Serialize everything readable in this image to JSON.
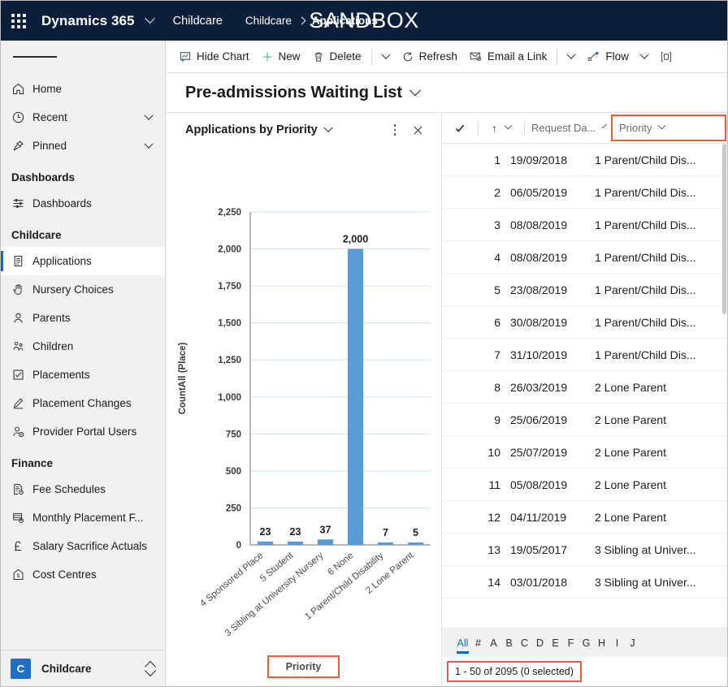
{
  "topbar": {
    "waffle_icon": "app-launcher-icon",
    "brand": "Dynamics 365",
    "brand_chevron_icon": "chevron-down-icon",
    "app_name": "Childcare",
    "breadcrumb_root": "Childcare",
    "breadcrumb_sep_icon": "chevron-right-icon",
    "breadcrumb_current": "Applications",
    "environment_banner": "SANDBOX"
  },
  "sidebar": {
    "hamburger_icon": "hamburger-menu-icon",
    "quick": [
      {
        "label": "Home",
        "icon": "home-icon",
        "chevron": false
      },
      {
        "label": "Recent",
        "icon": "clock-icon",
        "chevron": true
      },
      {
        "label": "Pinned",
        "icon": "pin-icon",
        "chevron": true
      }
    ],
    "groups": [
      {
        "title": "Dashboards",
        "items": [
          {
            "label": "Dashboards",
            "icon": "dashboard-icon",
            "active": false
          }
        ]
      },
      {
        "title": "Childcare",
        "items": [
          {
            "label": "Applications",
            "icon": "document-icon",
            "active": true
          },
          {
            "label": "Nursery Choices",
            "icon": "hand-icon",
            "active": false
          },
          {
            "label": "Parents",
            "icon": "person-icon",
            "active": false
          },
          {
            "label": "Children",
            "icon": "children-icon",
            "active": false
          },
          {
            "label": "Placements",
            "icon": "checkbox-icon",
            "active": false
          },
          {
            "label": "Placement Changes",
            "icon": "pencil-icon",
            "active": false
          },
          {
            "label": "Provider Portal Users",
            "icon": "person-settings-icon",
            "active": false
          }
        ]
      },
      {
        "title": "Finance",
        "items": [
          {
            "label": "Fee Schedules",
            "icon": "document-clock-icon",
            "active": false
          },
          {
            "label": "Monthly Placement F...",
            "icon": "list-clock-icon",
            "active": false
          },
          {
            "label": "Salary Sacrifice Actuals",
            "icon": "pound-icon",
            "active": false
          },
          {
            "label": "Cost Centres",
            "icon": "building-money-icon",
            "active": false
          }
        ]
      }
    ],
    "app_switcher": {
      "badge": "C",
      "label": "Childcare",
      "icon": "up-down-chevron-icon"
    }
  },
  "command_bar": {
    "items": [
      {
        "label": "Hide Chart",
        "icon": "chart-hide-icon"
      },
      {
        "label": "New",
        "icon": "plus-icon"
      },
      {
        "label": "Delete",
        "icon": "trash-icon"
      }
    ],
    "overflow_icon": "chevron-down-icon",
    "refresh": {
      "label": "Refresh",
      "icon": "refresh-icon"
    },
    "email_link": {
      "label": "Email a Link",
      "icon": "email-icon"
    },
    "email_chevron_icon": "chevron-down-icon",
    "flow": {
      "label": "Flow",
      "icon": "flow-icon"
    },
    "flow_chevron_icon": "chevron-down-icon",
    "run_report_icon": "run-report-icon"
  },
  "view": {
    "title": "Pre-admissions Waiting List",
    "chevron_icon": "chevron-down-icon"
  },
  "chart_panel": {
    "title": "Applications by Priority",
    "title_chevron_icon": "chevron-down-icon",
    "more_icon": "kebab-menu-icon",
    "close_icon": "close-icon",
    "legend_label": "Priority",
    "highlight_color": "#f05a3c"
  },
  "chart_data": {
    "type": "bar",
    "title": "Applications by Priority",
    "xlabel": "Priority",
    "ylabel": "CountAll (Place)",
    "categories": [
      "4 Sponsored Place",
      "5 Student",
      "3 Sibling at University Nursery",
      "6 None",
      "1 Parent/Child Disability",
      "2 Lone Parent"
    ],
    "values": [
      23,
      23,
      37,
      2000,
      7,
      5
    ],
    "data_labels": [
      "23",
      "23",
      "37",
      "2,000",
      "7",
      "5"
    ],
    "ylim": [
      0,
      2250
    ],
    "yticks": [
      0,
      250,
      500,
      750,
      1000,
      1250,
      1500,
      1750,
      2000,
      2250
    ],
    "ytick_labels": [
      "0",
      "250",
      "500",
      "750",
      "1,000",
      "1,250",
      "1,500",
      "1,750",
      "2,000",
      "2,250"
    ],
    "grid": true,
    "legend": "bottom",
    "bar_color": "#5b9bd5",
    "gridline_color": "#cfe2f3"
  },
  "grid": {
    "header": {
      "select_all_icon": "checkmark-icon",
      "sort_arrow_icon": "sort-ascending-icon",
      "sort_chevron_icon": "chevron-down-icon",
      "columns": [
        {
          "label": "Request Da...",
          "chevron_icon": "chevron-down-icon",
          "highlighted": false
        },
        {
          "label": "Priority",
          "chevron_icon": "chevron-down-icon",
          "highlighted": true
        }
      ]
    },
    "rows": [
      {
        "index": "1",
        "date": "19/09/2018",
        "priority": "1 Parent/Child Dis..."
      },
      {
        "index": "2",
        "date": "06/05/2019",
        "priority": "1 Parent/Child Dis..."
      },
      {
        "index": "3",
        "date": "08/08/2019",
        "priority": "1 Parent/Child Dis..."
      },
      {
        "index": "4",
        "date": "08/08/2019",
        "priority": "1 Parent/Child Dis..."
      },
      {
        "index": "5",
        "date": "23/08/2019",
        "priority": "1 Parent/Child Dis..."
      },
      {
        "index": "6",
        "date": "30/08/2019",
        "priority": "1 Parent/Child Dis..."
      },
      {
        "index": "7",
        "date": "31/10/2019",
        "priority": "1 Parent/Child Dis..."
      },
      {
        "index": "8",
        "date": "26/03/2019",
        "priority": "2 Lone Parent"
      },
      {
        "index": "9",
        "date": "25/06/2019",
        "priority": "2 Lone Parent"
      },
      {
        "index": "10",
        "date": "25/07/2019",
        "priority": "2 Lone Parent"
      },
      {
        "index": "11",
        "date": "05/08/2019",
        "priority": "2 Lone Parent"
      },
      {
        "index": "12",
        "date": "04/11/2019",
        "priority": "2 Lone Parent"
      },
      {
        "index": "13",
        "date": "19/05/2017",
        "priority": "3 Sibling at Univer..."
      },
      {
        "index": "14",
        "date": "03/01/2018",
        "priority": "3 Sibling at Univer..."
      }
    ],
    "alpha_filter": {
      "items": [
        "All",
        "#",
        "A",
        "B",
        "C",
        "D",
        "E",
        "F",
        "G",
        "H",
        "I",
        "J"
      ],
      "selected": "All"
    },
    "status": "1 - 50 of 2095 (0 selected)"
  }
}
